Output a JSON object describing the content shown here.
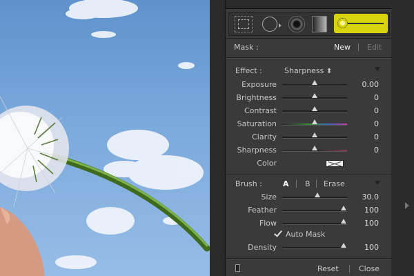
{
  "toolbar": {
    "icons": [
      "crop-overlay-icon",
      "spot-removal-icon",
      "red-eye-icon",
      "graduated-filter-icon",
      "adjustment-brush-icon"
    ],
    "active_tool": "adjustment-brush-icon",
    "active_color": "#d7d30c"
  },
  "mask": {
    "label": "Mask :",
    "new_label": "New",
    "edit_label": "Edit"
  },
  "effect": {
    "label": "Effect :",
    "selected": "Sharpness",
    "select_arrows": "⬍",
    "sliders": [
      {
        "label": "Exposure",
        "value": "0.00",
        "position": 0.5
      },
      {
        "label": "Brightness",
        "value": "0",
        "position": 0.5
      },
      {
        "label": "Contrast",
        "value": "0",
        "position": 0.5
      },
      {
        "label": "Saturation",
        "value": "0",
        "position": 0.5
      },
      {
        "label": "Clarity",
        "value": "0",
        "position": 0.5
      },
      {
        "label": "Sharpness",
        "value": "0",
        "position": 0.5
      }
    ],
    "color_label": "Color"
  },
  "brush": {
    "label": "Brush :",
    "tab_a": "A",
    "tab_b": "B",
    "erase": "Erase",
    "sliders": [
      {
        "label": "Size",
        "value": "30.0",
        "position": 0.55
      },
      {
        "label": "Feather",
        "value": "100",
        "position": 1.0
      },
      {
        "label": "Flow",
        "value": "100",
        "position": 1.0
      }
    ],
    "auto_mask_label": "Auto Mask",
    "auto_mask_checked": true,
    "density": {
      "label": "Density",
      "value": "100",
      "position": 1.0
    }
  },
  "footer": {
    "reset_label": "Reset",
    "close_label": "Close"
  },
  "colors": {
    "panel_bg": "#3a3a3a",
    "accent": "#d7d30c",
    "sky": "#6fa0d6"
  }
}
